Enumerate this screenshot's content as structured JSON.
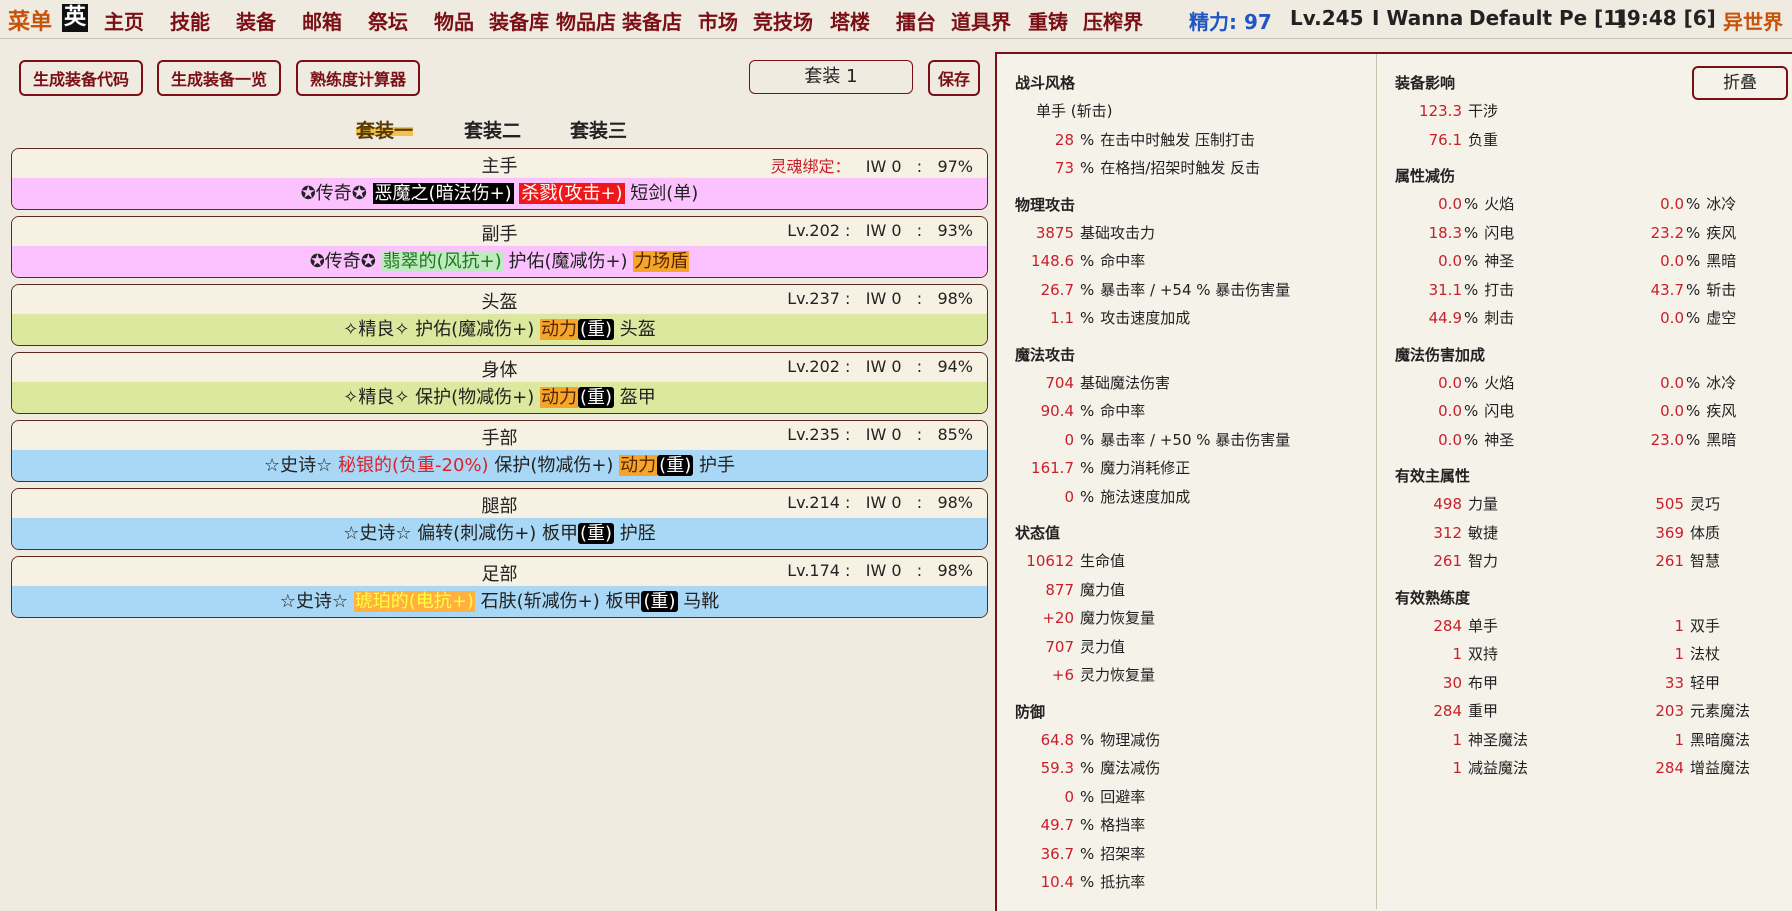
{
  "nav": {
    "menu": "菜单",
    "lang": "英",
    "items": [
      "主页",
      "技能",
      "装备",
      "邮箱",
      "祭坛",
      "物品",
      "装备库",
      "物品店",
      "装备店",
      "市场",
      "竞技场",
      "塔楼",
      "擂台",
      "道具界",
      "重铸",
      "压榨界"
    ],
    "stamina": "精力: 97",
    "level": "Lv.245",
    "player": "I Wanna",
    "persona": "Default Pe [1]",
    "time": "19:48 [6]",
    "world": "异世界"
  },
  "toolbar": {
    "gen_code": "生成装备代码",
    "gen_list": "生成装备一览",
    "calc": "熟练度计算器",
    "set_name": "套装 1",
    "save": "保存"
  },
  "set_tabs": [
    "套装一",
    "套装二",
    "套装三"
  ],
  "slots": [
    {
      "name": "主手",
      "info_prefix": "灵魂绑定：",
      "iw": "IW 0",
      "pct": "97%",
      "quality": "legend",
      "parts": [
        {
          "t": "✪传奇✪ ",
          "c": ""
        },
        {
          "t": "恶魔之(暗法伤+)",
          "c": "black"
        },
        {
          "t": " ",
          "c": ""
        },
        {
          "t": "杀戮(攻击+)",
          "c": "red"
        },
        {
          "t": " 短剑(单)",
          "c": ""
        }
      ]
    },
    {
      "name": "副手",
      "info_prefix": "Lv.202 :",
      "iw": "IW 0",
      "pct": "93%",
      "quality": "legend",
      "parts": [
        {
          "t": "✪传奇✪ ",
          "c": ""
        },
        {
          "t": "翡翠的(风抗+)",
          "c": "green"
        },
        {
          "t": " 护佑(魔减伤+) ",
          "c": ""
        },
        {
          "t": "力场盾",
          "c": "orange"
        }
      ]
    },
    {
      "name": "头盔",
      "info_prefix": "Lv.237 :",
      "iw": "IW 0",
      "pct": "98%",
      "quality": "fine",
      "parts": [
        {
          "t": "✧精良✧ 护佑(魔减伤+) ",
          "c": ""
        },
        {
          "t": "动力",
          "c": "orange"
        },
        {
          "t": "(重)",
          "c": "heavy"
        },
        {
          "t": " 头盔",
          "c": ""
        }
      ]
    },
    {
      "name": "身体",
      "info_prefix": "Lv.202 :",
      "iw": "IW 0",
      "pct": "94%",
      "quality": "fine",
      "parts": [
        {
          "t": "✧精良✧ 保护(物减伤+) ",
          "c": ""
        },
        {
          "t": "动力",
          "c": "orange"
        },
        {
          "t": "(重)",
          "c": "heavy"
        },
        {
          "t": " 盔甲",
          "c": ""
        }
      ]
    },
    {
      "name": "手部",
      "info_prefix": "Lv.235 :",
      "iw": "IW 0",
      "pct": "85%",
      "quality": "epic",
      "parts": [
        {
          "t": "☆史诗☆ ",
          "c": ""
        },
        {
          "t": "秘银的(负重-20%)",
          "c": "mithril"
        },
        {
          "t": " 保护(物减伤+) ",
          "c": ""
        },
        {
          "t": "动力",
          "c": "orange"
        },
        {
          "t": "(重)",
          "c": "heavy"
        },
        {
          "t": " 护手",
          "c": ""
        }
      ]
    },
    {
      "name": "腿部",
      "info_prefix": "Lv.214 :",
      "iw": "IW 0",
      "pct": "98%",
      "quality": "epic",
      "parts": [
        {
          "t": "☆史诗☆ 偏转(刺减伤+) 板甲",
          "c": ""
        },
        {
          "t": "(重)",
          "c": "heavy"
        },
        {
          "t": " 护胫",
          "c": ""
        }
      ]
    },
    {
      "name": "足部",
      "info_prefix": "Lv.174 :",
      "iw": "IW 0",
      "pct": "98%",
      "quality": "epic",
      "parts": [
        {
          "t": "☆史诗☆ ",
          "c": ""
        },
        {
          "t": "琥珀的(电抗+)",
          "c": "amber"
        },
        {
          "t": " 石肤(斩减伤+) 板甲",
          "c": ""
        },
        {
          "t": "(重)",
          "c": "heavy"
        },
        {
          "t": " 马靴",
          "c": ""
        }
      ]
    }
  ],
  "stats_left": [
    {
      "title": "战斗风格",
      "rows": [
        {
          "v": "",
          "pct": "",
          "label": "单手 (斩击)"
        },
        {
          "v": "28",
          "pct": "%",
          "label": "在击中时触发 压制打击"
        },
        {
          "v": "73",
          "pct": "%",
          "label": "在格挡/招架时触发 反击"
        }
      ]
    },
    {
      "title": "物理攻击",
      "rows": [
        {
          "v": "3875",
          "pct": "",
          "label": "基础攻击力"
        },
        {
          "v": "148.6",
          "pct": "%",
          "label": "命中率"
        },
        {
          "v": "26.7",
          "pct": "%",
          "label": "暴击率 / +54 % 暴击伤害量"
        },
        {
          "v": "1.1",
          "pct": "%",
          "label": "攻击速度加成"
        }
      ]
    },
    {
      "title": "魔法攻击",
      "rows": [
        {
          "v": "704",
          "pct": "",
          "label": "基础魔法伤害"
        },
        {
          "v": "90.4",
          "pct": "%",
          "label": "命中率"
        },
        {
          "v": "0",
          "pct": "%",
          "label": "暴击率 / +50 % 暴击伤害量"
        },
        {
          "v": "161.7",
          "pct": "%",
          "label": "魔力消耗修正"
        },
        {
          "v": "0",
          "pct": "%",
          "label": "施法速度加成"
        }
      ]
    },
    {
      "title": "状态值",
      "rows": [
        {
          "v": "10612",
          "pct": "",
          "label": "生命值"
        },
        {
          "v": "877",
          "pct": "",
          "label": "魔力值"
        },
        {
          "v": "+20",
          "pct": "",
          "label": "魔力恢复量"
        },
        {
          "v": "707",
          "pct": "",
          "label": "灵力值"
        },
        {
          "v": "+6",
          "pct": "",
          "label": "灵力恢复量"
        }
      ]
    },
    {
      "title": "防御",
      "rows": [
        {
          "v": "64.8",
          "pct": "%",
          "label": "物理减伤"
        },
        {
          "v": "59.3",
          "pct": "%",
          "label": "魔法减伤"
        },
        {
          "v": "0",
          "pct": "%",
          "label": "回避率"
        },
        {
          "v": "49.7",
          "pct": "%",
          "label": "格挡率"
        },
        {
          "v": "36.7",
          "pct": "%",
          "label": "招架率"
        },
        {
          "v": "10.4",
          "pct": "%",
          "label": "抵抗率"
        }
      ]
    }
  ],
  "collapse": "折叠",
  "stats_right": [
    {
      "title": "装备影响",
      "cols": 1,
      "rows": [
        {
          "v": "123.3",
          "label": "干涉"
        },
        {
          "v": "76.1",
          "label": "负重"
        }
      ]
    },
    {
      "title": "属性减伤",
      "cols": 2,
      "rows": [
        {
          "v": "0.0",
          "pct": "%",
          "label": "火焰",
          "v2": "0.0",
          "pct2": "%",
          "label2": "冰冷"
        },
        {
          "v": "18.3",
          "pct": "%",
          "label": "闪电",
          "v2": "23.2",
          "pct2": "%",
          "label2": "疾风"
        },
        {
          "v": "0.0",
          "pct": "%",
          "label": "神圣",
          "v2": "0.0",
          "pct2": "%",
          "label2": "黑暗"
        },
        {
          "v": "31.1",
          "pct": "%",
          "label": "打击",
          "v2": "43.7",
          "pct2": "%",
          "label2": "斩击"
        },
        {
          "v": "44.9",
          "pct": "%",
          "label": "刺击",
          "v2": "0.0",
          "pct2": "%",
          "label2": "虚空"
        }
      ]
    },
    {
      "title": "魔法伤害加成",
      "cols": 2,
      "rows": [
        {
          "v": "0.0",
          "pct": "%",
          "label": "火焰",
          "v2": "0.0",
          "pct2": "%",
          "label2": "冰冷"
        },
        {
          "v": "0.0",
          "pct": "%",
          "label": "闪电",
          "v2": "0.0",
          "pct2": "%",
          "label2": "疾风"
        },
        {
          "v": "0.0",
          "pct": "%",
          "label": "神圣",
          "v2": "23.0",
          "pct2": "%",
          "label2": "黑暗"
        }
      ]
    },
    {
      "title": "有效主属性",
      "cols": 2,
      "rows": [
        {
          "v": "498",
          "label": "力量",
          "v2": "505",
          "label2": "灵巧"
        },
        {
          "v": "312",
          "label": "敏捷",
          "v2": "369",
          "label2": "体质"
        },
        {
          "v": "261",
          "label": "智力",
          "v2": "261",
          "label2": "智慧"
        }
      ]
    },
    {
      "title": "有效熟练度",
      "cols": 2,
      "rows": [
        {
          "v": "284",
          "label": "单手",
          "v2": "1",
          "label2": "双手"
        },
        {
          "v": "1",
          "label": "双持",
          "v2": "1",
          "label2": "法杖"
        },
        {
          "v": "30",
          "label": "布甲",
          "v2": "33",
          "label2": "轻甲"
        },
        {
          "v": "284",
          "label": "重甲",
          "v2": "203",
          "label2": "元素魔法"
        },
        {
          "v": "1",
          "label": "神圣魔法",
          "v2": "1",
          "label2": "黑暗魔法"
        },
        {
          "v": "1",
          "label": "减益魔法",
          "v2": "284",
          "label2": "增益魔法"
        }
      ]
    }
  ]
}
